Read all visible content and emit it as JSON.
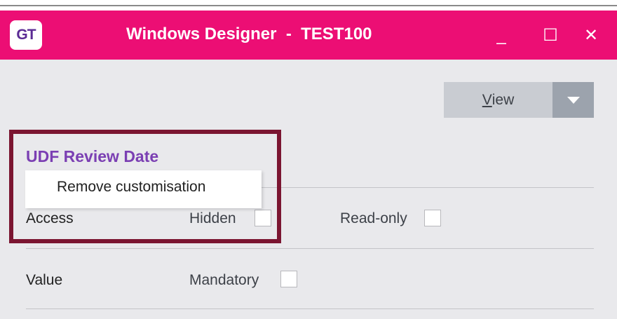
{
  "window": {
    "logo_text": "GT",
    "title": "Windows Designer  -  TEST100",
    "minimize_label": "_",
    "maximize_label": "☐",
    "close_label": "✕"
  },
  "toolbar": {
    "view_label": "View",
    "view_accelerator": "V",
    "view_rest": "iew",
    "view_dropdown_icon": "chevron-down-icon"
  },
  "field": {
    "title": "UDF Review Date"
  },
  "context_menu": {
    "items": [
      "Remove customisation"
    ]
  },
  "rows": [
    {
      "label": "Access",
      "options": [
        {
          "label": "Hidden",
          "checked": false
        },
        {
          "label": "Read-only",
          "checked": false
        }
      ]
    },
    {
      "label": "Value",
      "options": [
        {
          "label": "Mandatory",
          "checked": false
        }
      ]
    }
  ],
  "colors": {
    "titlebar": "#ec0e74",
    "highlight_frame": "#7b1531",
    "field_title": "#7b3fb3",
    "background": "#e9e9ec"
  }
}
